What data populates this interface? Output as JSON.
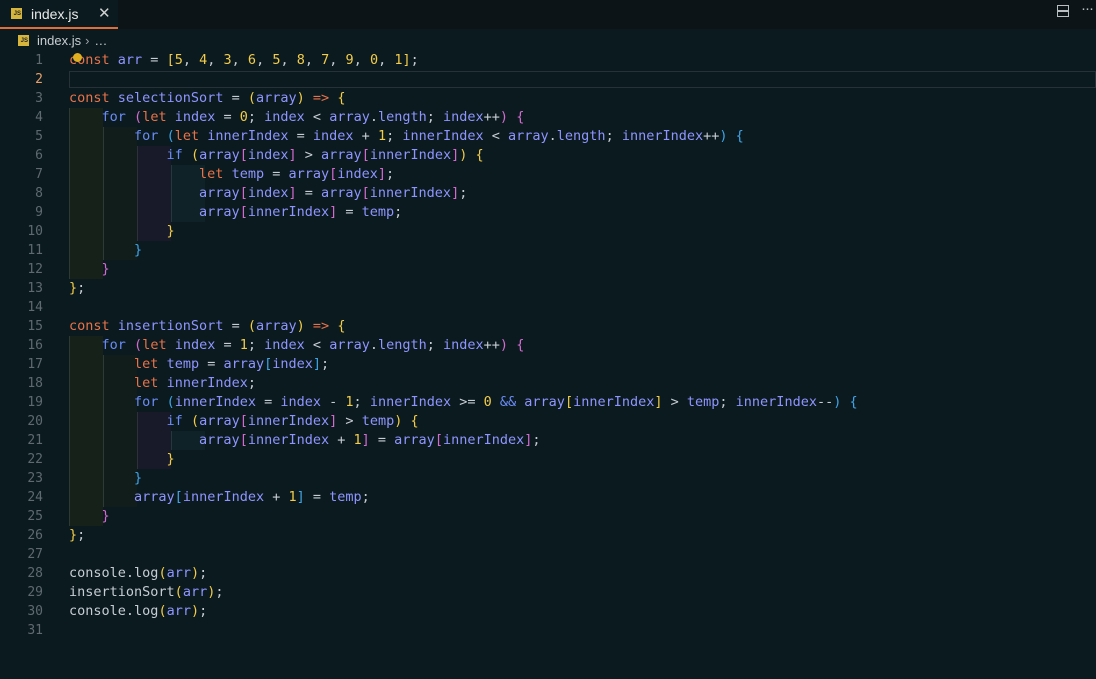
{
  "tab": {
    "label": "index.js",
    "badge": "JS",
    "close": "✕"
  },
  "breadcrumb": {
    "file": "index.js",
    "separator": "›",
    "more": "…"
  },
  "toolbar": {
    "more": "···"
  },
  "editor": {
    "active_line": 2,
    "lines": [
      [
        [
          "kw",
          "const"
        ],
        [
          "sp",
          " "
        ],
        [
          "id",
          "arr"
        ],
        [
          "op",
          " = "
        ],
        [
          "br1",
          "["
        ],
        [
          "num",
          "5"
        ],
        [
          "pn",
          ", "
        ],
        [
          "num",
          "4"
        ],
        [
          "pn",
          ", "
        ],
        [
          "num",
          "3"
        ],
        [
          "pn",
          ", "
        ],
        [
          "num",
          "6"
        ],
        [
          "pn",
          ", "
        ],
        [
          "num",
          "5"
        ],
        [
          "pn",
          ", "
        ],
        [
          "num",
          "8"
        ],
        [
          "pn",
          ", "
        ],
        [
          "num",
          "7"
        ],
        [
          "pn",
          ", "
        ],
        [
          "num",
          "9"
        ],
        [
          "pn",
          ", "
        ],
        [
          "num",
          "0"
        ],
        [
          "pn",
          ", "
        ],
        [
          "num",
          "1"
        ],
        [
          "br1",
          "]"
        ],
        [
          "pn",
          ";"
        ]
      ],
      [],
      [
        [
          "kw",
          "const"
        ],
        [
          "sp",
          " "
        ],
        [
          "id",
          "selectionSort"
        ],
        [
          "op",
          " = "
        ],
        [
          "br1",
          "("
        ],
        [
          "id",
          "array"
        ],
        [
          "br1",
          ")"
        ],
        [
          "op",
          " "
        ],
        [
          "kw",
          "=>"
        ],
        [
          "op",
          " "
        ],
        [
          "br1",
          "{"
        ]
      ],
      [
        [
          "sp",
          "    "
        ],
        [
          "kw2",
          "for"
        ],
        [
          "op",
          " "
        ],
        [
          "br2",
          "("
        ],
        [
          "kw",
          "let"
        ],
        [
          "op",
          " "
        ],
        [
          "id",
          "index"
        ],
        [
          "op",
          " = "
        ],
        [
          "num",
          "0"
        ],
        [
          "pn",
          "; "
        ],
        [
          "id",
          "index"
        ],
        [
          "op",
          " < "
        ],
        [
          "id",
          "array"
        ],
        [
          "pn",
          "."
        ],
        [
          "id",
          "length"
        ],
        [
          "pn",
          "; "
        ],
        [
          "id",
          "index"
        ],
        [
          "op",
          "++"
        ],
        [
          "br2",
          ")"
        ],
        [
          "op",
          " "
        ],
        [
          "br2",
          "{"
        ]
      ],
      [
        [
          "sp",
          "        "
        ],
        [
          "kw2",
          "for"
        ],
        [
          "op",
          " "
        ],
        [
          "br3",
          "("
        ],
        [
          "kw",
          "let"
        ],
        [
          "op",
          " "
        ],
        [
          "id",
          "innerIndex"
        ],
        [
          "op",
          " = "
        ],
        [
          "id",
          "index"
        ],
        [
          "op",
          " + "
        ],
        [
          "num",
          "1"
        ],
        [
          "pn",
          "; "
        ],
        [
          "id",
          "innerIndex"
        ],
        [
          "op",
          " < "
        ],
        [
          "id",
          "array"
        ],
        [
          "pn",
          "."
        ],
        [
          "id",
          "length"
        ],
        [
          "pn",
          "; "
        ],
        [
          "id",
          "innerIndex"
        ],
        [
          "op",
          "++"
        ],
        [
          "br3",
          ")"
        ],
        [
          "op",
          " "
        ],
        [
          "br3",
          "{"
        ]
      ],
      [
        [
          "sp",
          "            "
        ],
        [
          "kw2",
          "if"
        ],
        [
          "op",
          " "
        ],
        [
          "br1",
          "("
        ],
        [
          "id",
          "array"
        ],
        [
          "br2",
          "["
        ],
        [
          "id",
          "index"
        ],
        [
          "br2",
          "]"
        ],
        [
          "op",
          " > "
        ],
        [
          "id",
          "array"
        ],
        [
          "br2",
          "["
        ],
        [
          "id",
          "innerIndex"
        ],
        [
          "br2",
          "]"
        ],
        [
          "br1",
          ")"
        ],
        [
          "op",
          " "
        ],
        [
          "br1",
          "{"
        ]
      ],
      [
        [
          "sp",
          "                "
        ],
        [
          "kw",
          "let"
        ],
        [
          "op",
          " "
        ],
        [
          "id",
          "temp"
        ],
        [
          "op",
          " = "
        ],
        [
          "id",
          "array"
        ],
        [
          "br2",
          "["
        ],
        [
          "id",
          "index"
        ],
        [
          "br2",
          "]"
        ],
        [
          "pn",
          ";"
        ]
      ],
      [
        [
          "sp",
          "                "
        ],
        [
          "id",
          "array"
        ],
        [
          "br2",
          "["
        ],
        [
          "id",
          "index"
        ],
        [
          "br2",
          "]"
        ],
        [
          "op",
          " = "
        ],
        [
          "id",
          "array"
        ],
        [
          "br2",
          "["
        ],
        [
          "id",
          "innerIndex"
        ],
        [
          "br2",
          "]"
        ],
        [
          "pn",
          ";"
        ]
      ],
      [
        [
          "sp",
          "                "
        ],
        [
          "id",
          "array"
        ],
        [
          "br2",
          "["
        ],
        [
          "id",
          "innerIndex"
        ],
        [
          "br2",
          "]"
        ],
        [
          "op",
          " = "
        ],
        [
          "id",
          "temp"
        ],
        [
          "pn",
          ";"
        ]
      ],
      [
        [
          "sp",
          "            "
        ],
        [
          "br1",
          "}"
        ]
      ],
      [
        [
          "sp",
          "        "
        ],
        [
          "br3",
          "}"
        ]
      ],
      [
        [
          "sp",
          "    "
        ],
        [
          "br2",
          "}"
        ]
      ],
      [
        [
          "br1",
          "}"
        ],
        [
          "pn",
          ";"
        ]
      ],
      [],
      [
        [
          "kw",
          "const"
        ],
        [
          "sp",
          " "
        ],
        [
          "id",
          "insertionSort"
        ],
        [
          "op",
          " = "
        ],
        [
          "br1",
          "("
        ],
        [
          "id",
          "array"
        ],
        [
          "br1",
          ")"
        ],
        [
          "op",
          " "
        ],
        [
          "kw",
          "=>"
        ],
        [
          "op",
          " "
        ],
        [
          "br1",
          "{"
        ]
      ],
      [
        [
          "sp",
          "    "
        ],
        [
          "kw2",
          "for"
        ],
        [
          "op",
          " "
        ],
        [
          "br2",
          "("
        ],
        [
          "kw",
          "let"
        ],
        [
          "op",
          " "
        ],
        [
          "id",
          "index"
        ],
        [
          "op",
          " = "
        ],
        [
          "num",
          "1"
        ],
        [
          "pn",
          "; "
        ],
        [
          "id",
          "index"
        ],
        [
          "op",
          " < "
        ],
        [
          "id",
          "array"
        ],
        [
          "pn",
          "."
        ],
        [
          "id",
          "length"
        ],
        [
          "pn",
          "; "
        ],
        [
          "id",
          "index"
        ],
        [
          "op",
          "++"
        ],
        [
          "br2",
          ")"
        ],
        [
          "op",
          " "
        ],
        [
          "br2",
          "{"
        ]
      ],
      [
        [
          "sp",
          "        "
        ],
        [
          "kw",
          "let"
        ],
        [
          "op",
          " "
        ],
        [
          "id",
          "temp"
        ],
        [
          "op",
          " = "
        ],
        [
          "id",
          "array"
        ],
        [
          "br3",
          "["
        ],
        [
          "id",
          "index"
        ],
        [
          "br3",
          "]"
        ],
        [
          "pn",
          ";"
        ]
      ],
      [
        [
          "sp",
          "        "
        ],
        [
          "kw",
          "let"
        ],
        [
          "op",
          " "
        ],
        [
          "id",
          "innerIndex"
        ],
        [
          "pn",
          ";"
        ]
      ],
      [
        [
          "sp",
          "        "
        ],
        [
          "kw2",
          "for"
        ],
        [
          "op",
          " "
        ],
        [
          "br3",
          "("
        ],
        [
          "id",
          "innerIndex"
        ],
        [
          "op",
          " = "
        ],
        [
          "id",
          "index"
        ],
        [
          "op",
          " - "
        ],
        [
          "num",
          "1"
        ],
        [
          "pn",
          "; "
        ],
        [
          "id",
          "innerIndex"
        ],
        [
          "op",
          " >= "
        ],
        [
          "num",
          "0"
        ],
        [
          "op",
          " "
        ],
        [
          "kw2",
          "&&"
        ],
        [
          "op",
          " "
        ],
        [
          "id",
          "array"
        ],
        [
          "br1",
          "["
        ],
        [
          "id",
          "innerIndex"
        ],
        [
          "br1",
          "]"
        ],
        [
          "op",
          " > "
        ],
        [
          "id",
          "temp"
        ],
        [
          "pn",
          "; "
        ],
        [
          "id",
          "innerIndex"
        ],
        [
          "op",
          "--"
        ],
        [
          "br3",
          ")"
        ],
        [
          "op",
          " "
        ],
        [
          "br3",
          "{"
        ]
      ],
      [
        [
          "sp",
          "            "
        ],
        [
          "kw2",
          "if"
        ],
        [
          "op",
          " "
        ],
        [
          "br1",
          "("
        ],
        [
          "id",
          "array"
        ],
        [
          "br2",
          "["
        ],
        [
          "id",
          "innerIndex"
        ],
        [
          "br2",
          "]"
        ],
        [
          "op",
          " > "
        ],
        [
          "id",
          "temp"
        ],
        [
          "br1",
          ")"
        ],
        [
          "op",
          " "
        ],
        [
          "br1",
          "{"
        ]
      ],
      [
        [
          "sp",
          "                "
        ],
        [
          "id",
          "array"
        ],
        [
          "br2",
          "["
        ],
        [
          "id",
          "innerIndex"
        ],
        [
          "op",
          " + "
        ],
        [
          "num",
          "1"
        ],
        [
          "br2",
          "]"
        ],
        [
          "op",
          " = "
        ],
        [
          "id",
          "array"
        ],
        [
          "br2",
          "["
        ],
        [
          "id",
          "innerIndex"
        ],
        [
          "br2",
          "]"
        ],
        [
          "pn",
          ";"
        ]
      ],
      [
        [
          "sp",
          "            "
        ],
        [
          "br1",
          "}"
        ]
      ],
      [
        [
          "sp",
          "        "
        ],
        [
          "br3",
          "}"
        ]
      ],
      [
        [
          "sp",
          "        "
        ],
        [
          "id",
          "array"
        ],
        [
          "br3",
          "["
        ],
        [
          "id",
          "innerIndex"
        ],
        [
          "op",
          " + "
        ],
        [
          "num",
          "1"
        ],
        [
          "br3",
          "]"
        ],
        [
          "op",
          " = "
        ],
        [
          "id",
          "temp"
        ],
        [
          "pn",
          ";"
        ]
      ],
      [
        [
          "sp",
          "    "
        ],
        [
          "br2",
          "}"
        ]
      ],
      [
        [
          "br1",
          "}"
        ],
        [
          "pn",
          ";"
        ]
      ],
      [],
      [
        [
          "fn",
          "console"
        ],
        [
          "pn",
          "."
        ],
        [
          "fn",
          "log"
        ],
        [
          "br1",
          "("
        ],
        [
          "id",
          "arr"
        ],
        [
          "br1",
          ")"
        ],
        [
          "pn",
          ";"
        ]
      ],
      [
        [
          "fn",
          "insertionSort"
        ],
        [
          "br1",
          "("
        ],
        [
          "id",
          "arr"
        ],
        [
          "br1",
          ")"
        ],
        [
          "pn",
          ";"
        ]
      ],
      [
        [
          "fn",
          "console"
        ],
        [
          "pn",
          "."
        ],
        [
          "fn",
          "log"
        ],
        [
          "br1",
          "("
        ],
        [
          "id",
          "arr"
        ],
        [
          "br1",
          ")"
        ],
        [
          "pn",
          ";"
        ]
      ],
      []
    ]
  },
  "colors": {
    "background": "#0b1a1f",
    "keyword": "#e8734a",
    "control": "#6b8cf6",
    "identifier": "#8f95ff",
    "number": "#f2cc4a",
    "bracket_level1": "#f2cc4a",
    "bracket_level2": "#d36ad0",
    "bracket_level3": "#3fa5e8",
    "tab_accent": "#e06c3a"
  }
}
